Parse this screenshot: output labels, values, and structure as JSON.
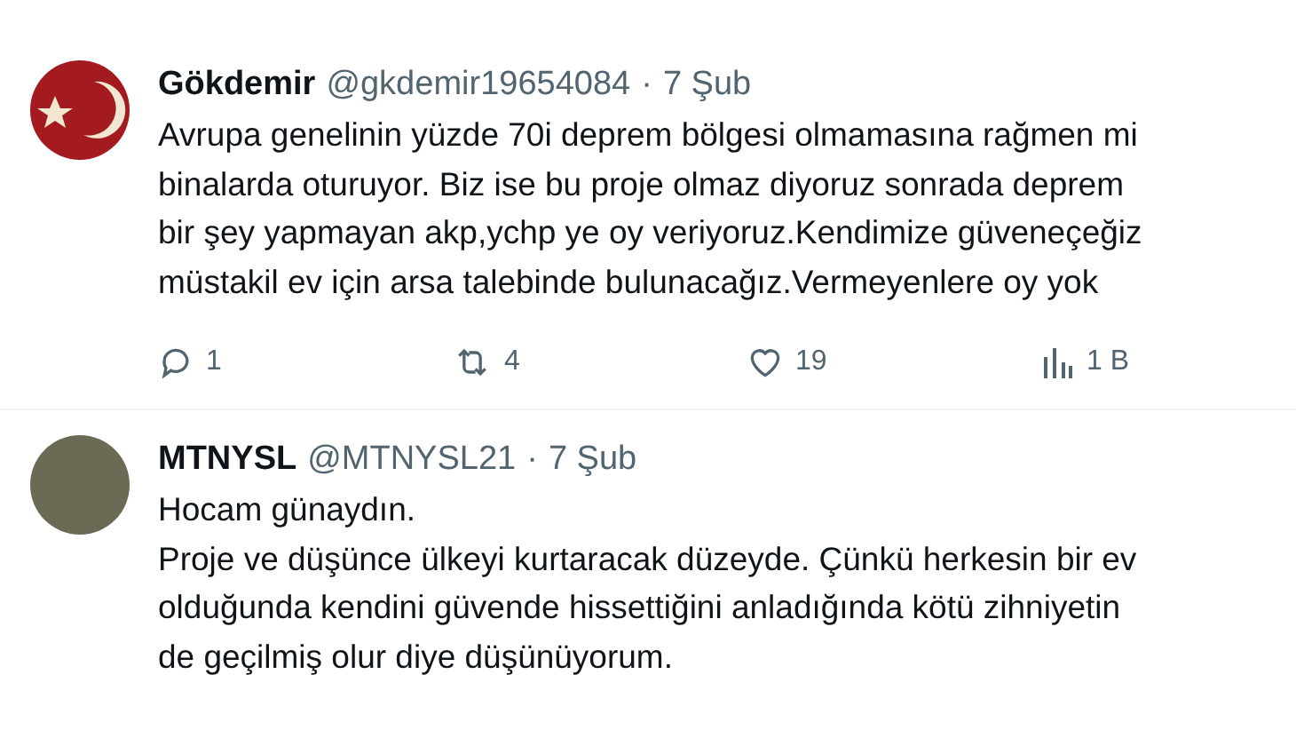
{
  "tweets": [
    {
      "kind": "flag",
      "name": "Gökdemir",
      "handle": "@gkdemir19654084",
      "separator": "·",
      "date": "7 Şub",
      "lines": [
        "Avrupa genelinin yüzde 70i deprem bölgesi olmamasına rağmen mi",
        "binalarda oturuyor. Biz ise bu proje olmaz diyoruz sonrada deprem",
        "bir şey yapmayan akp,ychp ye oy veriyoruz.Kendimize güveneçeğiz",
        "müstakil ev için arsa talebinde bulunacağız.Vermeyenlere oy yok"
      ],
      "actions": {
        "replies": "1",
        "reposts": "4",
        "likes": "19",
        "views": "1 B"
      }
    },
    {
      "kind": "photo",
      "name": "MTNYSL",
      "handle": "@MTNYSL21",
      "separator": "·",
      "date": "7 Şub",
      "lines": [
        "Hocam günaydın.",
        "Proje ve düşünce ülkeyi kurtaracak düzeyde. Çünkü herkesin bir ev",
        "olduğunda kendini güvende hissettiğini anladığında kötü zihniyetin",
        "de geçilmiş olur diye düşünüyorum."
      ]
    }
  ]
}
